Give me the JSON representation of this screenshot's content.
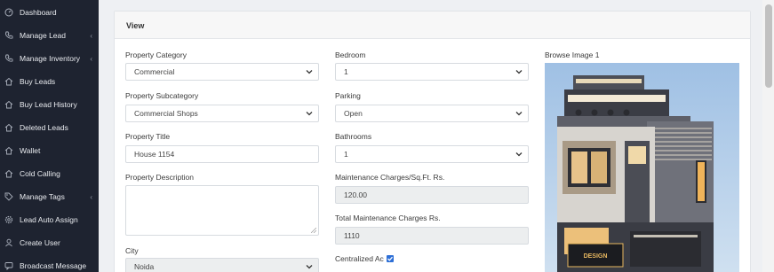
{
  "sidebar": {
    "items": [
      {
        "label": "Dashboard",
        "icon": "dashboard-icon",
        "chevron": ""
      },
      {
        "label": "Manage Lead",
        "icon": "phone-icon",
        "chevron": "‹"
      },
      {
        "label": "Manage Inventory",
        "icon": "phone-icon",
        "chevron": "‹"
      },
      {
        "label": "Buy Leads",
        "icon": "home-icon",
        "chevron": ""
      },
      {
        "label": "Buy Lead History",
        "icon": "home-icon",
        "chevron": ""
      },
      {
        "label": "Deleted Leads",
        "icon": "home-icon",
        "chevron": ""
      },
      {
        "label": "Wallet",
        "icon": "home-icon",
        "chevron": ""
      },
      {
        "label": "Cold Calling",
        "icon": "home-icon",
        "chevron": ""
      },
      {
        "label": "Manage Tags",
        "icon": "tag-icon",
        "chevron": "‹"
      },
      {
        "label": "Lead Auto Assign",
        "icon": "gear-icon",
        "chevron": ""
      },
      {
        "label": "Create User",
        "icon": "user-icon",
        "chevron": ""
      },
      {
        "label": "Broadcast Message",
        "icon": "message-icon",
        "chevron": ""
      }
    ]
  },
  "card": {
    "title": "View"
  },
  "form": {
    "property_category": {
      "label": "Property Category",
      "value": "Commercial"
    },
    "property_subcategory": {
      "label": "Property Subcategory",
      "value": "Commercial Shops"
    },
    "property_title": {
      "label": "Property Title",
      "value": "House 1154"
    },
    "property_description": {
      "label": "Property Description",
      "value": ""
    },
    "city": {
      "label": "City",
      "value": "Noida"
    },
    "bedroom": {
      "label": "Bedroom",
      "value": "1"
    },
    "parking": {
      "label": "Parking",
      "value": "Open"
    },
    "bathrooms": {
      "label": "Bathrooms",
      "value": "1"
    },
    "maintenance_charges": {
      "label": "Maintenance Charges/Sq.Ft. Rs.",
      "value": "120.00"
    },
    "total_maintenance": {
      "label": "Total Maintenance Charges Rs.",
      "value": "1110"
    },
    "centralized_ac": {
      "label": "Centralized Ac",
      "checked": true
    }
  },
  "image": {
    "label": "Browse Image 1",
    "sign_text": "DESIGN"
  },
  "colors": {
    "sidebar": "#1e2330",
    "accent": "#2d6fd6"
  }
}
